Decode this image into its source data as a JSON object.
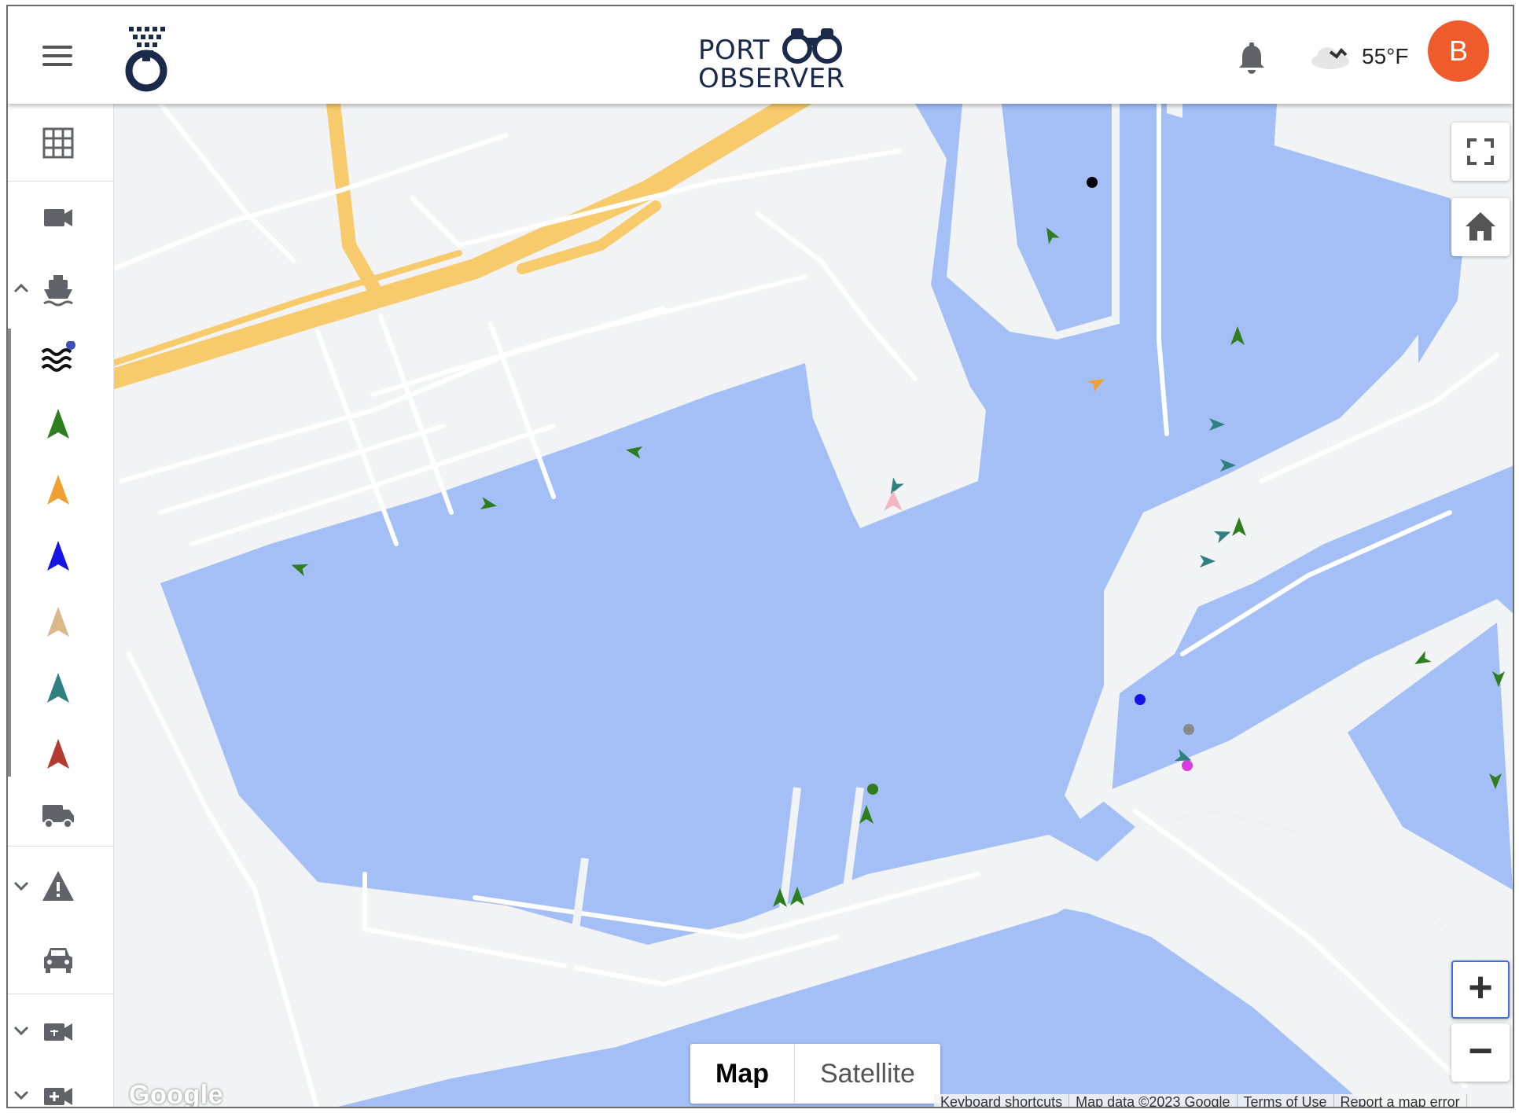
{
  "header": {
    "brand_line1": "PORT",
    "brand_line2": "OBSERVER",
    "temperature": "55°F",
    "avatar_initial": "B",
    "avatar_color": "#ef5b2a"
  },
  "sidebar": {
    "items": [
      {
        "name": "grid-icon"
      },
      {
        "name": "camera-icon"
      },
      {
        "name": "ship-icon",
        "expandable": "collapse"
      },
      {
        "name": "waves-icon",
        "badge": true
      },
      {
        "name": "vessel-marker-green-icon",
        "color": "#2e7d1f"
      },
      {
        "name": "vessel-marker-orange-icon",
        "color": "#f0a030"
      },
      {
        "name": "vessel-marker-blue-icon",
        "color": "#1414e6"
      },
      {
        "name": "vessel-marker-tan-icon",
        "color": "#d9b98a"
      },
      {
        "name": "vessel-marker-teal-icon",
        "color": "#2f8080"
      },
      {
        "name": "vessel-marker-red-icon",
        "color": "#b23a2e"
      },
      {
        "name": "truck-icon"
      },
      {
        "name": "warning-icon",
        "expandable": "expand"
      },
      {
        "name": "car-icon"
      },
      {
        "name": "video-camera-icon",
        "expandable": "expand"
      },
      {
        "name": "add-camera-icon",
        "expandable": "expand"
      }
    ]
  },
  "map": {
    "type_control": {
      "map_label": "Map",
      "satellite_label": "Satellite",
      "selected": "Map"
    },
    "google_logo": "Google",
    "footer": [
      "Keyboard shortcuts",
      "Map data ©2023 Google",
      "Terms of Use",
      "Report a map error"
    ],
    "zoom_in_label": "+",
    "zoom_out_label": "−",
    "colors": {
      "water": "#a3bff5",
      "land": "#f1f3f4",
      "highway": "#f7ca6b",
      "road": "#ffffff"
    }
  }
}
